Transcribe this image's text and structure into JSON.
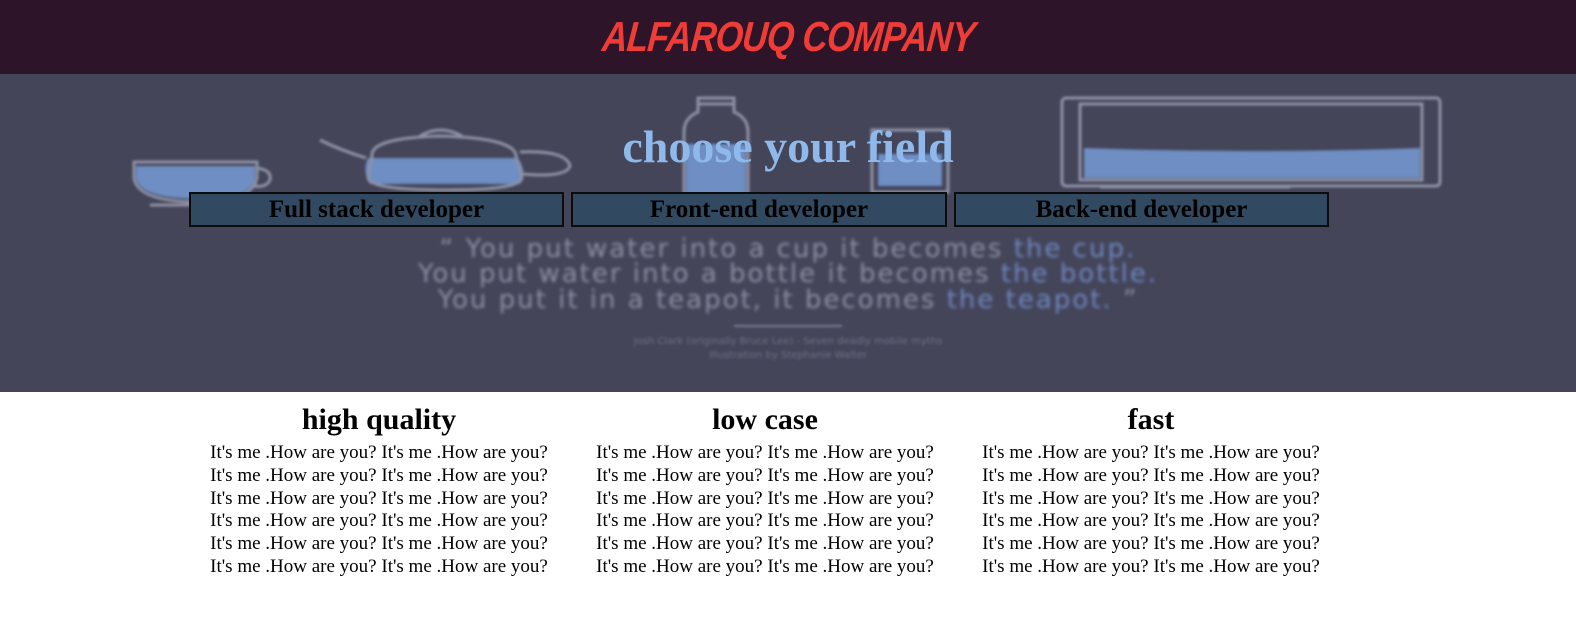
{
  "header": {
    "brand": "ALFAROUQ COMPANY"
  },
  "hero": {
    "title": "choose your field",
    "buttons": [
      {
        "label": "Full stack developer"
      },
      {
        "label": "Front-end developer"
      },
      {
        "label": "Back-end developer"
      }
    ],
    "background_quote": {
      "lines": [
        {
          "open": "“",
          "text": "You put water into a cup it becomes ",
          "highlight": "the cup."
        },
        {
          "text": "You put water into a bottle it becomes ",
          "highlight": "the bottle."
        },
        {
          "text": "You put it in a teapot, it becomes ",
          "highlight": "the teapot.",
          "close": "”"
        }
      ],
      "credit_line_1": "Josh Clark (originally Bruce Lee) - Seven deadly mobile myths",
      "credit_line_2": "Illustration by Stephanie Walter"
    }
  },
  "features": [
    {
      "title": "high quality",
      "lines": [
        "It's me .How are you? It's me .How are you?",
        "It's me .How are you? It's me .How are you?",
        "It's me .How are you? It's me .How are you?",
        "It's me .How are you? It's me .How are you?",
        "It's me .How are you? It's me .How are you?",
        "It's me .How are you? It's me .How are you?"
      ]
    },
    {
      "title": "low case",
      "lines": [
        "It's me .How are you? It's me .How are you?",
        "It's me .How are you? It's me .How are you?",
        "It's me .How are you? It's me .How are you?",
        "It's me .How are you? It's me .How are you?",
        "It's me .How are you? It's me .How are you?",
        "It's me .How are you? It's me .How are you?"
      ]
    },
    {
      "title": "fast",
      "lines": [
        "It's me .How are you? It's me .How are you?",
        "It's me .How are you? It's me .How are you?",
        "It's me .How are you? It's me .How are you?",
        "It's me .How are you? It's me .How are you?",
        "It's me .How are you? It's me .How are you?",
        "It's me .How are you? It's me .How are you?"
      ]
    }
  ],
  "colors": {
    "topbar": "#2d1428",
    "brand": "#f03c37",
    "hero_bg": "#444559",
    "hero_title": "#8fb9ea",
    "button_bg": "#324a61",
    "illustration_fill": "#6e8ec4"
  },
  "icons": [
    "cup-illustration",
    "teapot-illustration",
    "bottle-illustration",
    "glass-illustration",
    "monitor-illustration"
  ]
}
